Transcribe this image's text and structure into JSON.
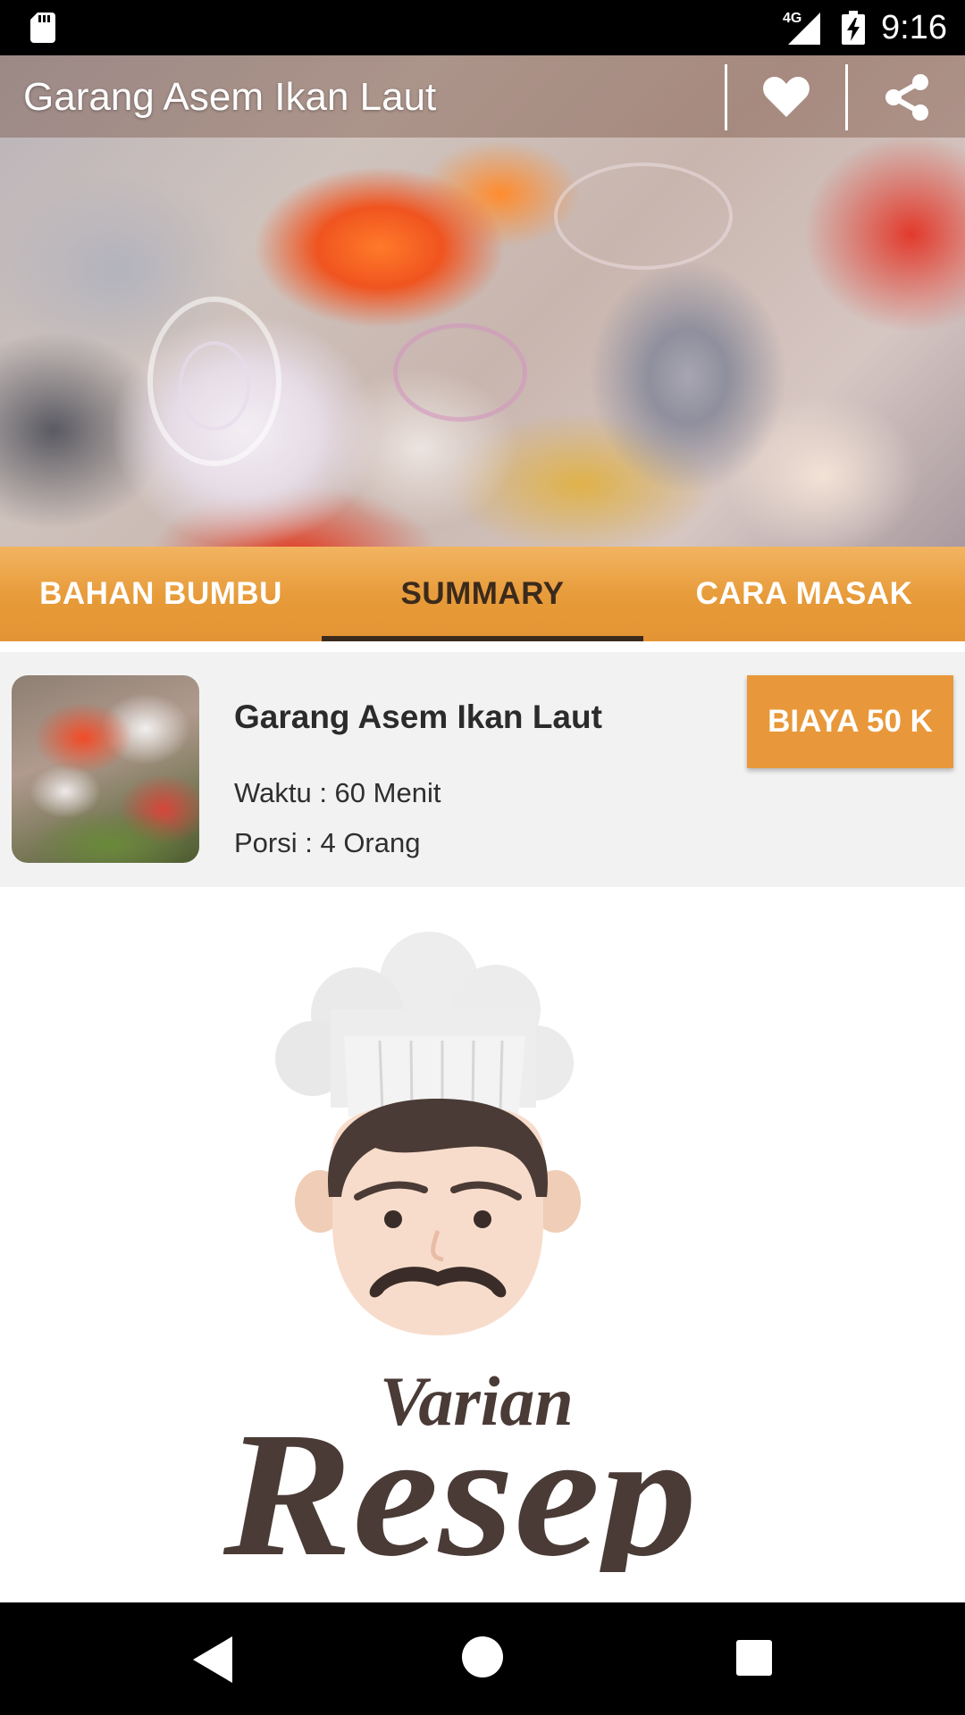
{
  "status_bar": {
    "time": "9:16",
    "network": "4G",
    "icons": [
      "sd-card-icon",
      "signal-icon",
      "battery-charging-icon"
    ]
  },
  "app_bar": {
    "title": "Garang Asem Ikan Laut",
    "actions": [
      {
        "name": "favorite",
        "icon": "heart-icon"
      },
      {
        "name": "share",
        "icon": "share-icon"
      }
    ]
  },
  "tabs": [
    {
      "label": "BAHAN BUMBU",
      "active": false
    },
    {
      "label": "SUMMARY",
      "active": true
    },
    {
      "label": "CARA MASAK",
      "active": false
    }
  ],
  "summary": {
    "name": "Garang Asem Ikan Laut",
    "time": "Waktu : 60 Menit",
    "portion": "Porsi : 4 Orang",
    "cost_button": "BIAYA 50 K"
  },
  "logo": {
    "line1": "Varian",
    "line2": "Resep"
  },
  "nav_bar": {
    "icons": [
      "back-icon",
      "home-icon",
      "recents-icon"
    ]
  },
  "colors": {
    "accent": "#E8983A",
    "tab_active_text": "#3B2A1C",
    "logo_brown": "#4A3B36",
    "status_bar": "#000000"
  }
}
